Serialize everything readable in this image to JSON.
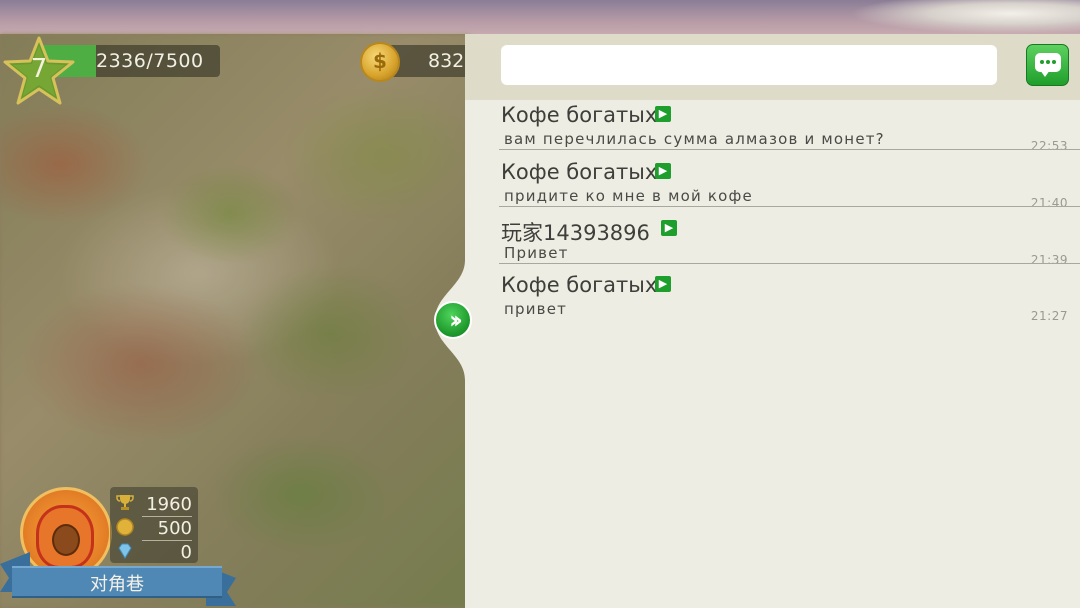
{
  "hud": {
    "level": "7",
    "xp_text": "2336/7500",
    "xp_progress": 0.3115,
    "coins": "832",
    "coin_symbol": "$"
  },
  "player": {
    "trophies": "1960",
    "coins": "500",
    "gems": "0",
    "name": "对角巷"
  },
  "chat": {
    "search_placeholder": "",
    "messages": [
      {
        "sender": "Кофе богатых",
        "text": "вам перечлилась сумма алмазов и монет?",
        "time": "22:53"
      },
      {
        "sender": "Кофе богатых",
        "text": "придите ко мне в мой кофе",
        "time": "21:40"
      },
      {
        "sender": "玩家14393896",
        "text": "Привет",
        "time": "21:39"
      },
      {
        "sender": "Кофе богатых",
        "text": "привет",
        "time": "21:27"
      }
    ]
  },
  "colors": {
    "accent_green": "#1e9e2c",
    "panel_bg": "#eeede3",
    "header_bg": "#dedcc8",
    "ribbon_blue": "#4f87b5"
  },
  "icons": {
    "level": "star-icon",
    "coin": "coin-icon",
    "trophy": "trophy-icon",
    "gem": "gem-icon",
    "chat": "chat-bubble-icon",
    "expand": "double-chevron-right-icon",
    "sender_arrow": "arrow-right-icon"
  }
}
